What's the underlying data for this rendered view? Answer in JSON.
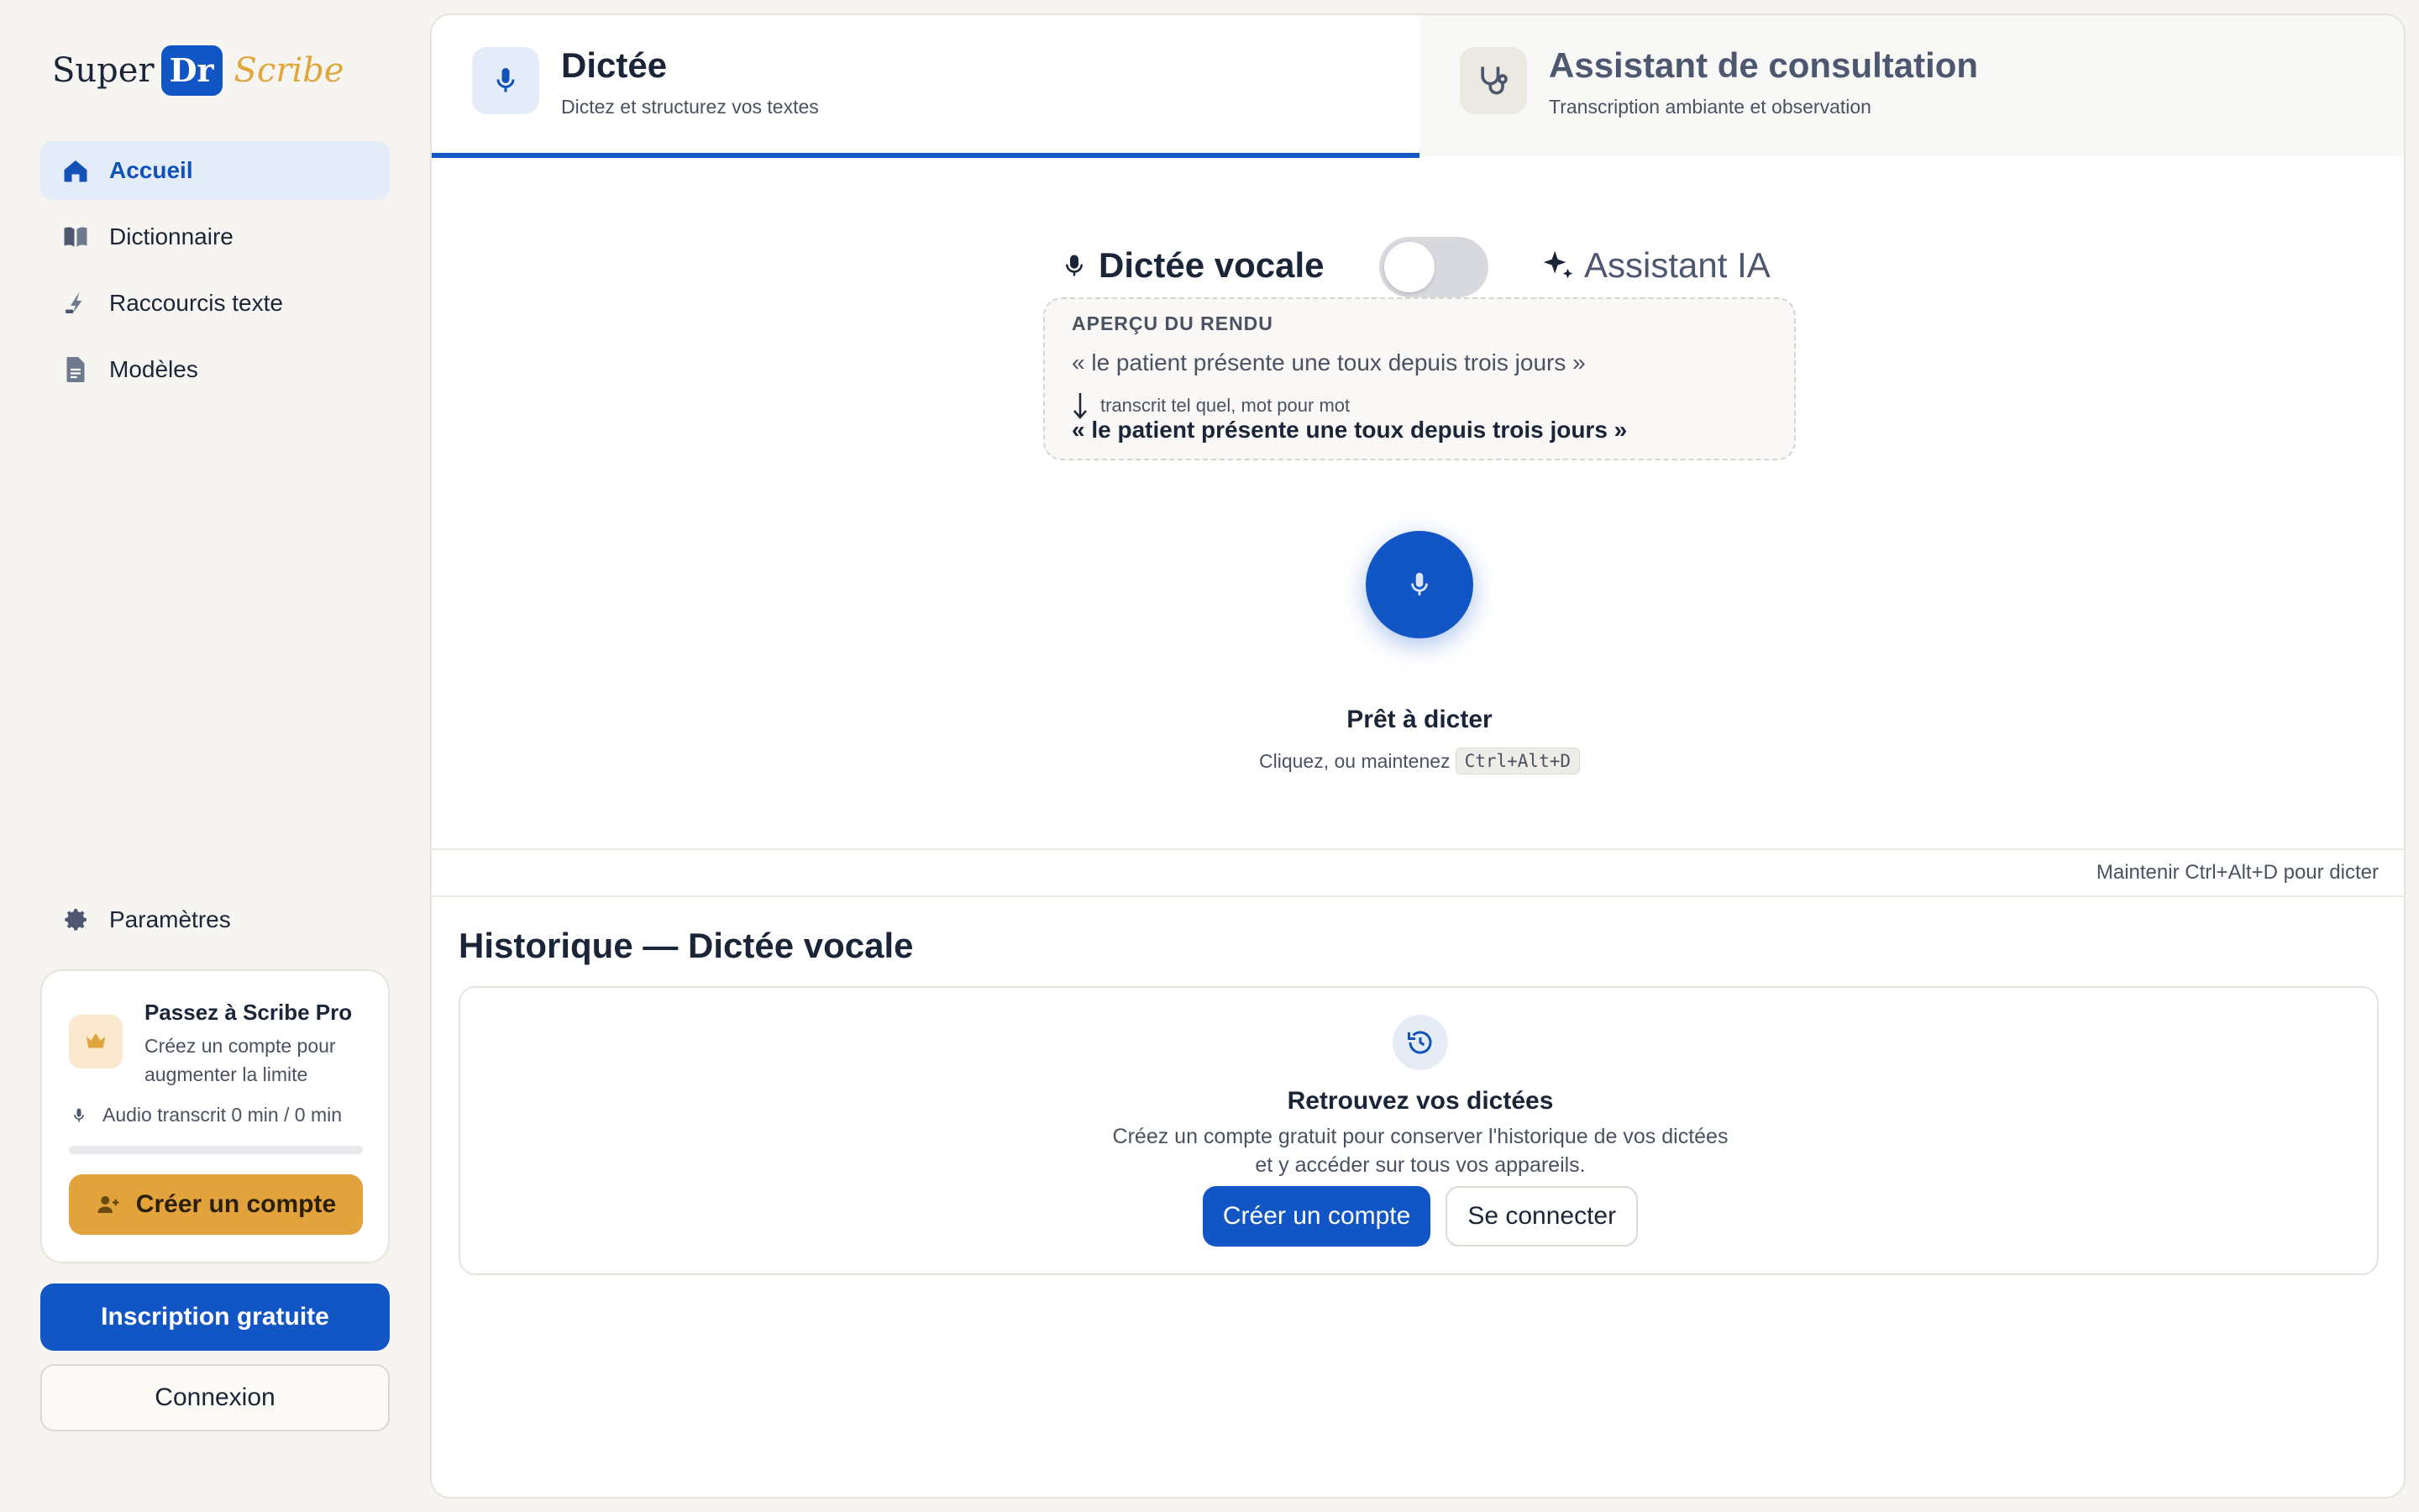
{
  "brand": {
    "super": "Super",
    "dr": "Dr",
    "scribe": "Scribe"
  },
  "sidebar": {
    "items": [
      {
        "label": "Accueil",
        "icon": "home-icon",
        "active": true
      },
      {
        "label": "Dictionnaire",
        "icon": "book-icon",
        "active": false
      },
      {
        "label": "Raccourcis texte",
        "icon": "shortcut-icon",
        "active": false
      },
      {
        "label": "Modèles",
        "icon": "document-icon",
        "active": false
      }
    ],
    "settings_label": "Paramètres"
  },
  "pro_card": {
    "title": "Passez à Scribe Pro",
    "subtitle": "Créez un compte pour augmenter la limite",
    "audio_label": "Audio transcrit 0 min / 0 min",
    "usage_fraction": 0,
    "create_account": "Créer un compte"
  },
  "auth": {
    "signup": "Inscription gratuite",
    "login": "Connexion"
  },
  "tabs": [
    {
      "title": "Dictée",
      "subtitle": "Dictez et structurez vos textes",
      "icon": "microphone-icon",
      "active": true
    },
    {
      "title": "Assistant de consultation",
      "subtitle": "Transcription ambiante et observation",
      "icon": "stethoscope-icon",
      "active": false
    }
  ],
  "mode": {
    "left_label": "Dictée vocale",
    "right_label": "Assistant IA",
    "toggle_on": false
  },
  "preview": {
    "label": "APERÇU DU RENDU",
    "raw": "« le patient présente une toux depuis trois jours »",
    "note": "transcrit tel quel, mot pour mot",
    "final": "« le patient présente une toux depuis trois jours »"
  },
  "dictate": {
    "status": "Prêt à dicter",
    "hint_prefix": "Cliquez, ou maintenez",
    "shortcut": "Ctrl+Alt+D"
  },
  "hint_bar": "Maintenir Ctrl+Alt+D pour dicter",
  "history": {
    "title": "Historique — Dictée vocale",
    "heading": "Retrouvez vos dictées",
    "text_line1": "Créez un compte gratuit pour conserver l'historique de vos dictées",
    "text_line2": "et y accéder sur tous vos appareils.",
    "primary_button": "Créer un compte",
    "secondary_button": "Se connecter"
  },
  "colors": {
    "accent": "#1256c6",
    "pro_accent": "#e2a23c",
    "background": "#f6f5f1"
  }
}
